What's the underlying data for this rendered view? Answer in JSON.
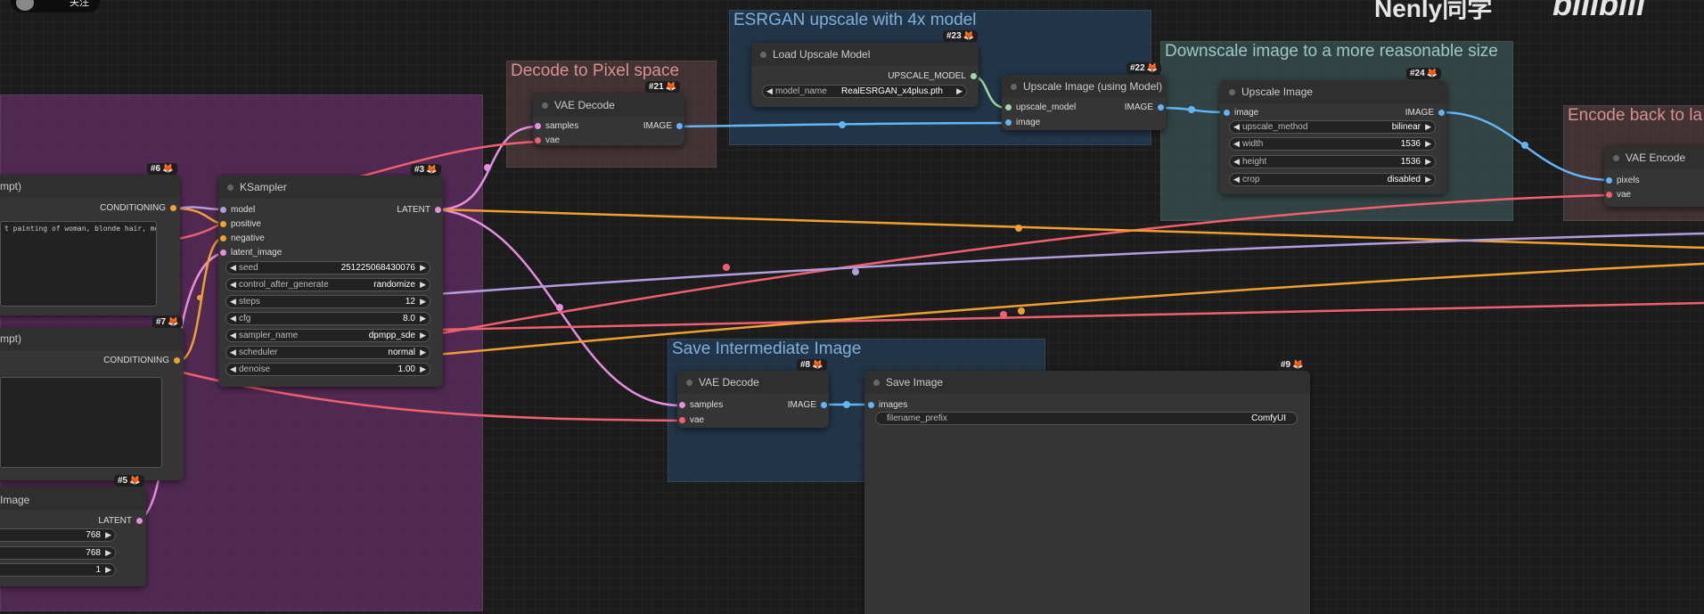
{
  "watermarks": {
    "left": "Nenly同学",
    "right": "bilibili"
  },
  "top_badge": {
    "text": "关注"
  },
  "groups": {
    "decode": "Decode to Pixel space",
    "esrgan": "ESRGAN upscale with 4x model",
    "downscale": "Downscale image to a more reasonable size",
    "encode": "Encode back to la",
    "save": "Save Intermediate Image"
  },
  "nodes": {
    "clip_top": {
      "title": "mpt)",
      "badge": "#6",
      "out": "CONDITIONING",
      "text": "t painting of woman, blonde hair, mountain"
    },
    "clip_bottom": {
      "title": "mpt)",
      "badge": "#7",
      "out": "CONDITIONING"
    },
    "latent": {
      "title": "Image",
      "badge": "#5",
      "out": "LATENT",
      "width": "768",
      "height": "768",
      "batch": "1"
    },
    "ksampler": {
      "title": "KSampler",
      "badge": "#3",
      "out": "LATENT",
      "inputs": [
        "model",
        "positive",
        "negative",
        "latent_image"
      ],
      "widgets": [
        {
          "label": "seed",
          "value": "251225068430076"
        },
        {
          "label": "control_after_generate",
          "value": "randomize"
        },
        {
          "label": "steps",
          "value": "12"
        },
        {
          "label": "cfg",
          "value": "8.0"
        },
        {
          "label": "sampler_name",
          "value": "dpmpp_sde"
        },
        {
          "label": "scheduler",
          "value": "normal"
        },
        {
          "label": "denoise",
          "value": "1.00"
        }
      ]
    },
    "vae_decode_21": {
      "title": "VAE Decode",
      "badge": "#21",
      "in1": "samples",
      "in2": "vae",
      "out": "IMAGE"
    },
    "load_upscale": {
      "title": "Load Upscale Model",
      "badge": "#23",
      "out": "UPSCALE_MODEL",
      "w_label": "model_name",
      "w_value": "RealESRGAN_x4plus.pth"
    },
    "upscale_model": {
      "title": "Upscale Image (using Model)",
      "badge": "#22",
      "in1": "upscale_model",
      "in2": "image",
      "out": "IMAGE"
    },
    "upscale_image": {
      "title": "Upscale Image",
      "badge": "#24",
      "in1": "image",
      "out": "IMAGE",
      "widgets": [
        {
          "label": "upscale_method",
          "value": "bilinear"
        },
        {
          "label": "width",
          "value": "1536"
        },
        {
          "label": "height",
          "value": "1536"
        },
        {
          "label": "crop",
          "value": "disabled"
        }
      ]
    },
    "vae_encode": {
      "title": "VAE Encode",
      "in1": "pixels",
      "in2": "vae"
    },
    "vae_decode_8": {
      "title": "VAE Decode",
      "badge": "#8",
      "in1": "samples",
      "in2": "vae",
      "out": "IMAGE"
    },
    "save_image": {
      "title": "Save Image",
      "badge": "#9",
      "in1": "images",
      "w_label": "filename_prefix",
      "w_value": "ComfyUI"
    }
  },
  "colors": {
    "model": "#b39ddb",
    "conditioning": "#f0a030",
    "latent": "#e88ee0",
    "vae": "#f06070",
    "image": "#64b5f6",
    "upscale_model": "#a5d6a7"
  }
}
